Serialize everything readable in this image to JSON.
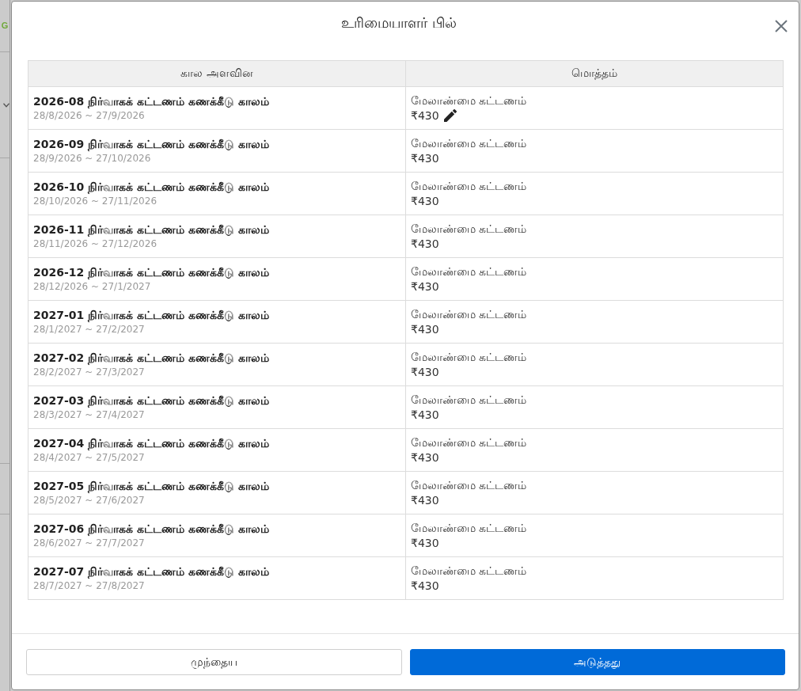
{
  "background_page": {
    "logo_text": "G"
  },
  "dialog": {
    "title": "உரிமையாளர் பில்"
  },
  "table": {
    "columns": [
      "கால அளவின",
      "மொத்தம்"
    ],
    "rows": [
      {
        "period": "2026-08 நிர்வாகக் கட்டணம் கணக்கீடு காலம்",
        "dates": "28/8/2026 ~ 27/9/2026",
        "fee_label": "மேலாண்மை கட்டணம்",
        "amount": "₹430",
        "editable": true
      },
      {
        "period": "2026-09 நிர்வாகக் கட்டணம் கணக்கீடு காலம்",
        "dates": "28/9/2026 ~ 27/10/2026",
        "fee_label": "மேலாண்மை கட்டணம்",
        "amount": "₹430",
        "editable": false
      },
      {
        "period": "2026-10 நிர்வாகக் கட்டணம் கணக்கீடு காலம்",
        "dates": "28/10/2026 ~ 27/11/2026",
        "fee_label": "மேலாண்மை கட்டணம்",
        "amount": "₹430",
        "editable": false
      },
      {
        "period": "2026-11 நிர்வாகக் கட்டணம் கணக்கீடு காலம்",
        "dates": "28/11/2026 ~ 27/12/2026",
        "fee_label": "மேலாண்மை கட்டணம்",
        "amount": "₹430",
        "editable": false
      },
      {
        "period": "2026-12 நிர்வாகக் கட்டணம் கணக்கீடு காலம்",
        "dates": "28/12/2026 ~ 27/1/2027",
        "fee_label": "மேலாண்மை கட்டணம்",
        "amount": "₹430",
        "editable": false
      },
      {
        "period": "2027-01 நிர்வாகக் கட்டணம் கணக்கீடு காலம்",
        "dates": "28/1/2027 ~ 27/2/2027",
        "fee_label": "மேலாண்மை கட்டணம்",
        "amount": "₹430",
        "editable": false
      },
      {
        "period": "2027-02 நிர்வாகக் கட்டணம் கணக்கீடு காலம்",
        "dates": "28/2/2027 ~ 27/3/2027",
        "fee_label": "மேலாண்மை கட்டணம்",
        "amount": "₹430",
        "editable": false
      },
      {
        "period": "2027-03 நிர்வாகக் கட்டணம் கணக்கீடு காலம்",
        "dates": "28/3/2027 ~ 27/4/2027",
        "fee_label": "மேலாண்மை கட்டணம்",
        "amount": "₹430",
        "editable": false
      },
      {
        "period": "2027-04 நிர்வாகக் கட்டணம் கணக்கீடு காலம்",
        "dates": "28/4/2027 ~ 27/5/2027",
        "fee_label": "மேலாண்மை கட்டணம்",
        "amount": "₹430",
        "editable": false
      },
      {
        "period": "2027-05 நிர்வாகக் கட்டணம் கணக்கீடு காலம்",
        "dates": "28/5/2027 ~ 27/6/2027",
        "fee_label": "மேலாண்மை கட்டணம்",
        "amount": "₹430",
        "editable": false
      },
      {
        "period": "2027-06 நிர்வாகக் கட்டணம் கணக்கீடு காலம்",
        "dates": "28/6/2027 ~ 27/7/2027",
        "fee_label": "மேலாண்மை கட்டணம்",
        "amount": "₹430",
        "editable": false
      },
      {
        "period": "2027-07 நிர்வாகக் கட்டணம் கணக்கீடு காலம்",
        "dates": "28/7/2027 ~ 27/8/2027",
        "fee_label": "மேலாண்மை கட்டணம்",
        "amount": "₹430",
        "editable": false
      }
    ]
  },
  "buttons": [
    {
      "label": "முந்தைய",
      "kind": "secondary"
    },
    {
      "label": "அடுத்தது",
      "kind": "primary"
    }
  ]
}
